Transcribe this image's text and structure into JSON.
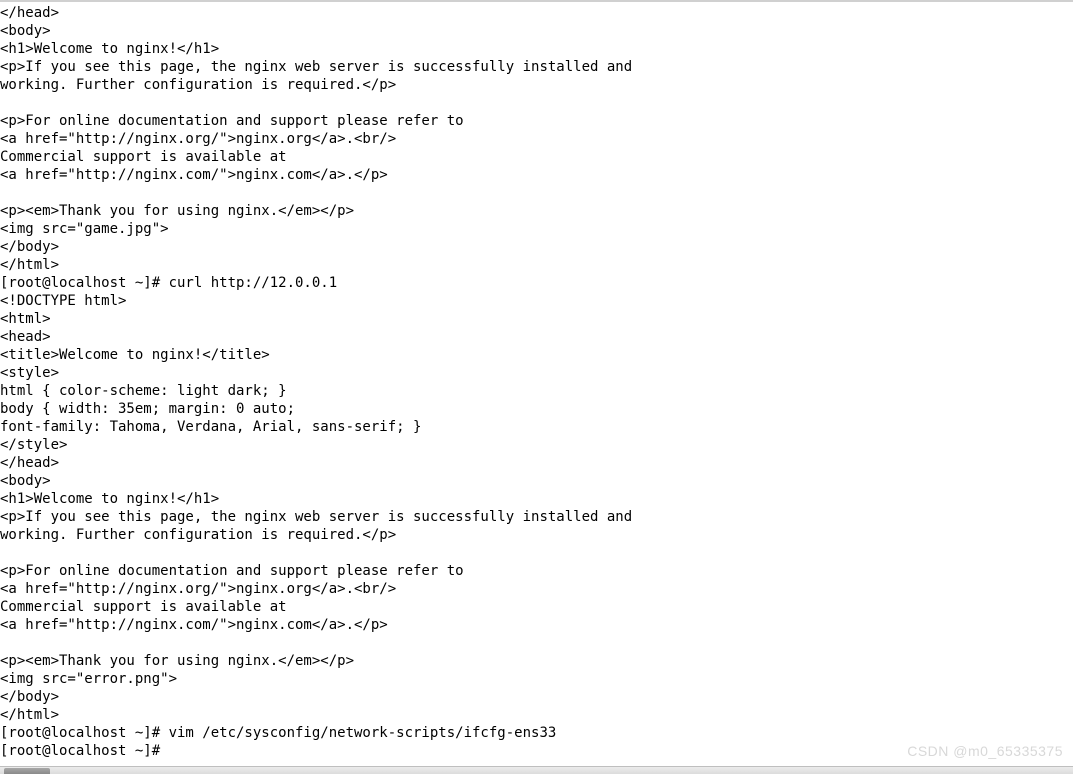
{
  "terminal": {
    "lines": [
      "</head>",
      "<body>",
      "<h1>Welcome to nginx!</h1>",
      "<p>If you see this page, the nginx web server is successfully installed and",
      "working. Further configuration is required.</p>",
      "",
      "<p>For online documentation and support please refer to",
      "<a href=\"http://nginx.org/\">nginx.org</a>.<br/>",
      "Commercial support is available at",
      "<a href=\"http://nginx.com/\">nginx.com</a>.</p>",
      "",
      "<p><em>Thank you for using nginx.</em></p>",
      "<img src=\"game.jpg\">",
      "</body>",
      "</html>",
      "[root@localhost ~]# curl http://12.0.0.1",
      "<!DOCTYPE html>",
      "<html>",
      "<head>",
      "<title>Welcome to nginx!</title>",
      "<style>",
      "html { color-scheme: light dark; }",
      "body { width: 35em; margin: 0 auto;",
      "font-family: Tahoma, Verdana, Arial, sans-serif; }",
      "</style>",
      "</head>",
      "<body>",
      "<h1>Welcome to nginx!</h1>",
      "<p>If you see this page, the nginx web server is successfully installed and",
      "working. Further configuration is required.</p>",
      "",
      "<p>For online documentation and support please refer to",
      "<a href=\"http://nginx.org/\">nginx.org</a>.<br/>",
      "Commercial support is available at",
      "<a href=\"http://nginx.com/\">nginx.com</a>.</p>",
      "",
      "<p><em>Thank you for using nginx.</em></p>",
      "<img src=\"error.png\">",
      "</body>",
      "</html>",
      "[root@localhost ~]# vim /etc/sysconfig/network-scripts/ifcfg-ens33",
      "[root@localhost ~]# "
    ]
  },
  "watermark": "CSDN @m0_65335375"
}
